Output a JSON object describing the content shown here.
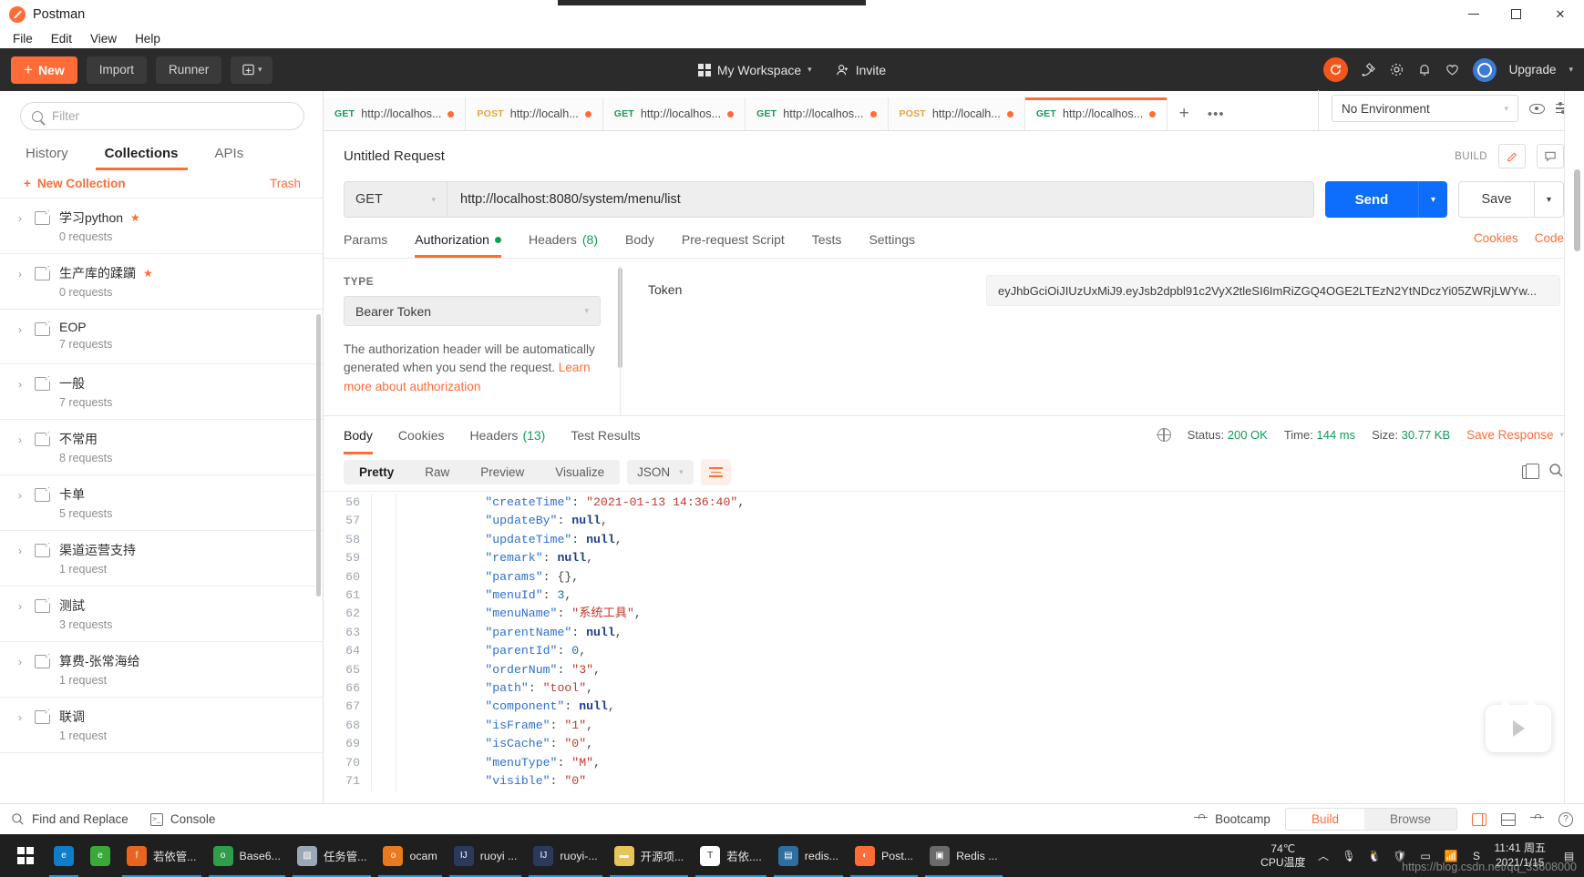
{
  "window": {
    "title": "Postman",
    "minimize": "—",
    "maximize": "▢",
    "close": "✕"
  },
  "menubar": {
    "items": [
      "File",
      "Edit",
      "View",
      "Help"
    ]
  },
  "toolbar": {
    "new_label": "New",
    "new_plus": "+",
    "import_label": "Import",
    "runner_label": "Runner",
    "workspace_label": "My Workspace",
    "workspace_caret": "▾",
    "invite_label": "Invite",
    "upgrade_label": "Upgrade",
    "upgrade_caret": "▾",
    "sync_icon": "refresh-icon",
    "accent": "#ff6c37"
  },
  "sidebar": {
    "search": {
      "placeholder": "Filter",
      "value": ""
    },
    "tabs": [
      {
        "label": "History",
        "active": false
      },
      {
        "label": "Collections",
        "active": true
      },
      {
        "label": "APIs",
        "active": false
      }
    ],
    "new_collection": "New Collection",
    "new_collection_plus": "+",
    "trash": "Trash",
    "collections": [
      {
        "name": "学习python",
        "count": "0 requests",
        "starred": true
      },
      {
        "name": "生产库的蹂躏",
        "count": "0 requests",
        "starred": true
      },
      {
        "name": "EOP",
        "count": "7 requests",
        "starred": false
      },
      {
        "name": "一般",
        "count": "7 requests",
        "starred": false
      },
      {
        "name": "不常用",
        "count": "8 requests",
        "starred": false
      },
      {
        "name": "卡单",
        "count": "5 requests",
        "starred": false
      },
      {
        "name": "渠道运营支持",
        "count": "1 request",
        "starred": false
      },
      {
        "name": "测試",
        "count": "3 requests",
        "starred": false
      },
      {
        "name": "算费-张常海给",
        "count": "1 request",
        "starred": false
      },
      {
        "name": "联调",
        "count": "1 request",
        "starred": false
      }
    ]
  },
  "request_tabs": {
    "items": [
      {
        "method": "GET",
        "url": "http://localhos...",
        "unsaved": true,
        "active": false
      },
      {
        "method": "POST",
        "url": "http://localh...",
        "unsaved": true,
        "active": false
      },
      {
        "method": "GET",
        "url": "http://localhos...",
        "unsaved": true,
        "active": false
      },
      {
        "method": "GET",
        "url": "http://localhos...",
        "unsaved": true,
        "active": false
      },
      {
        "method": "POST",
        "url": "http://localh...",
        "unsaved": true,
        "active": false
      },
      {
        "method": "GET",
        "url": "http://localhos...",
        "unsaved": true,
        "active": true
      }
    ],
    "add": "+",
    "more": "•••"
  },
  "environment": {
    "selected": "No Environment",
    "caret": "▾",
    "eye_icon": "eye-icon",
    "settings_icon": "sliders-icon"
  },
  "request": {
    "name": "Untitled Request",
    "build_label": "BUILD",
    "method": "GET",
    "method_caret": "▾",
    "url": "http://localhost:8080/system/menu/list",
    "send_label": "Send",
    "send_caret": "▾",
    "save_label": "Save",
    "save_caret": "▾",
    "tabs": [
      {
        "label": "Params",
        "active": false,
        "dot": false,
        "count": ""
      },
      {
        "label": "Authorization",
        "active": true,
        "dot": true,
        "count": ""
      },
      {
        "label": "Headers",
        "active": false,
        "dot": false,
        "count": "(8)"
      },
      {
        "label": "Body",
        "active": false,
        "dot": false,
        "count": ""
      },
      {
        "label": "Pre-request Script",
        "active": false,
        "dot": false,
        "count": ""
      },
      {
        "label": "Tests",
        "active": false,
        "dot": false,
        "count": ""
      },
      {
        "label": "Settings",
        "active": false,
        "dot": false,
        "count": ""
      }
    ],
    "cookies_link": "Cookies",
    "code_link": "Code"
  },
  "authorization": {
    "type_label": "TYPE",
    "type_value": "Bearer Token",
    "type_caret": "▾",
    "note_text": "The authorization header will be automatically generated when you send the request. ",
    "note_link": "Learn more about authorization",
    "token_label": "Token",
    "token_value": "eyJhbGciOiJIUzUxMiJ9.eyJsb2dpbl91c2VyX2tleSI6ImRiZGQ4OGE2LTEzN2YtNDczYi05ZWRjLWYw..."
  },
  "response": {
    "tabs": [
      {
        "label": "Body",
        "active": true,
        "count": ""
      },
      {
        "label": "Cookies",
        "active": false,
        "count": ""
      },
      {
        "label": "Headers",
        "active": false,
        "count": "(13)"
      },
      {
        "label": "Test Results",
        "active": false,
        "count": ""
      }
    ],
    "status_label": "Status:",
    "status_value": "200 OK",
    "time_label": "Time:",
    "time_value": "144 ms",
    "size_label": "Size:",
    "size_value": "30.77 KB",
    "save_response": "Save Response",
    "save_response_caret": "▾",
    "formats": [
      {
        "label": "Pretty",
        "active": true
      },
      {
        "label": "Raw",
        "active": false
      },
      {
        "label": "Preview",
        "active": false
      },
      {
        "label": "Visualize",
        "active": false
      }
    ],
    "language": "JSON",
    "language_caret": "▾",
    "wrap_icon": "word-wrap-icon",
    "copy_icon": "copy-icon",
    "search_icon": "search-icon",
    "code_lines": [
      {
        "num": "56",
        "parts": [
          {
            "t": "\"createTime\"",
            "c": "k"
          },
          {
            "t": ": ",
            "c": "p"
          },
          {
            "t": "\"2021-01-13 14:36:40\"",
            "c": "s"
          },
          {
            "t": ",",
            "c": "p"
          }
        ]
      },
      {
        "num": "57",
        "parts": [
          {
            "t": "\"updateBy\"",
            "c": "k"
          },
          {
            "t": ": ",
            "c": "p"
          },
          {
            "t": "null",
            "c": "nul"
          },
          {
            "t": ",",
            "c": "p"
          }
        ]
      },
      {
        "num": "58",
        "parts": [
          {
            "t": "\"updateTime\"",
            "c": "k"
          },
          {
            "t": ": ",
            "c": "p"
          },
          {
            "t": "null",
            "c": "nul"
          },
          {
            "t": ",",
            "c": "p"
          }
        ]
      },
      {
        "num": "59",
        "parts": [
          {
            "t": "\"remark\"",
            "c": "k"
          },
          {
            "t": ": ",
            "c": "p"
          },
          {
            "t": "null",
            "c": "nul"
          },
          {
            "t": ",",
            "c": "p"
          }
        ]
      },
      {
        "num": "60",
        "parts": [
          {
            "t": "\"params\"",
            "c": "k"
          },
          {
            "t": ": {},",
            "c": "p"
          }
        ]
      },
      {
        "num": "61",
        "parts": [
          {
            "t": "\"menuId\"",
            "c": "k"
          },
          {
            "t": ": ",
            "c": "p"
          },
          {
            "t": "3",
            "c": "n"
          },
          {
            "t": ",",
            "c": "p"
          }
        ]
      },
      {
        "num": "62",
        "parts": [
          {
            "t": "\"menuName\"",
            "c": "k"
          },
          {
            "t": ": ",
            "c": "p"
          },
          {
            "t": "\"系统工具\"",
            "c": "s"
          },
          {
            "t": ",",
            "c": "p"
          }
        ]
      },
      {
        "num": "63",
        "parts": [
          {
            "t": "\"parentName\"",
            "c": "k"
          },
          {
            "t": ": ",
            "c": "p"
          },
          {
            "t": "null",
            "c": "nul"
          },
          {
            "t": ",",
            "c": "p"
          }
        ]
      },
      {
        "num": "64",
        "parts": [
          {
            "t": "\"parentId\"",
            "c": "k"
          },
          {
            "t": ": ",
            "c": "p"
          },
          {
            "t": "0",
            "c": "n"
          },
          {
            "t": ",",
            "c": "p"
          }
        ]
      },
      {
        "num": "65",
        "parts": [
          {
            "t": "\"orderNum\"",
            "c": "k"
          },
          {
            "t": ": ",
            "c": "p"
          },
          {
            "t": "\"3\"",
            "c": "s"
          },
          {
            "t": ",",
            "c": "p"
          }
        ]
      },
      {
        "num": "66",
        "parts": [
          {
            "t": "\"path\"",
            "c": "k"
          },
          {
            "t": ": ",
            "c": "p"
          },
          {
            "t": "\"tool\"",
            "c": "s"
          },
          {
            "t": ",",
            "c": "p"
          }
        ]
      },
      {
        "num": "67",
        "parts": [
          {
            "t": "\"component\"",
            "c": "k"
          },
          {
            "t": ": ",
            "c": "p"
          },
          {
            "t": "null",
            "c": "nul"
          },
          {
            "t": ",",
            "c": "p"
          }
        ]
      },
      {
        "num": "68",
        "parts": [
          {
            "t": "\"isFrame\"",
            "c": "k"
          },
          {
            "t": ": ",
            "c": "p"
          },
          {
            "t": "\"1\"",
            "c": "s"
          },
          {
            "t": ",",
            "c": "p"
          }
        ]
      },
      {
        "num": "69",
        "parts": [
          {
            "t": "\"isCache\"",
            "c": "k"
          },
          {
            "t": ": ",
            "c": "p"
          },
          {
            "t": "\"0\"",
            "c": "s"
          },
          {
            "t": ",",
            "c": "p"
          }
        ]
      },
      {
        "num": "70",
        "parts": [
          {
            "t": "\"menuType\"",
            "c": "k"
          },
          {
            "t": ": ",
            "c": "p"
          },
          {
            "t": "\"M\"",
            "c": "s"
          },
          {
            "t": ",",
            "c": "p"
          }
        ]
      },
      {
        "num": "71",
        "parts": [
          {
            "t": "\"visible\"",
            "c": "k"
          },
          {
            "t": ": ",
            "c": "p"
          },
          {
            "t": "\"0\"",
            "c": "s"
          }
        ]
      }
    ]
  },
  "statusbar": {
    "find_replace": "Find and Replace",
    "console": "Console",
    "bootcamp": "Bootcamp",
    "build": "Build",
    "browse": "Browse",
    "two_pane_icon": "two-pane-icon",
    "split_pane_icon": "split-pane-icon",
    "keyboard_icon": "keyboard-icon",
    "help_icon": "help-icon"
  },
  "taskbar": {
    "start_icon": "windows-start-icon",
    "apps": [
      {
        "label": "",
        "icon": "edge-icon",
        "color": "#0f7ec8",
        "glyph": "e",
        "open": true
      },
      {
        "label": "",
        "icon": "ie-icon",
        "color": "#3aa93a",
        "glyph": "e",
        "open": false
      },
      {
        "label": "若依管...",
        "icon": "firefox-icon",
        "color": "#e8641f",
        "glyph": "f",
        "open": true
      },
      {
        "label": "Base6...",
        "icon": "chrome-icon",
        "color": "#2e9e4a",
        "glyph": "o",
        "open": true
      },
      {
        "label": "任务管...",
        "icon": "taskmgr-icon",
        "color": "#9aa8b5",
        "glyph": "▨",
        "open": true
      },
      {
        "label": "ocam",
        "icon": "ocam-icon",
        "color": "#e87a1f",
        "glyph": "o",
        "open": true
      },
      {
        "label": "ruoyi ...",
        "icon": "intellij-icon",
        "color": "#2b3a5c",
        "glyph": "IJ",
        "open": true
      },
      {
        "label": "ruoyi-...",
        "icon": "intellij-icon",
        "color": "#2b3a5c",
        "glyph": "IJ",
        "open": true
      },
      {
        "label": "开源项...",
        "icon": "folder-icon",
        "color": "#e8c35a",
        "glyph": "▬",
        "open": true
      },
      {
        "label": "若依....",
        "icon": "typora-icon",
        "color": "#ffffff",
        "glyph": "T",
        "open": true
      },
      {
        "label": "redis...",
        "icon": "redis-desktop-icon",
        "color": "#2f6f9f",
        "glyph": "▤",
        "open": true
      },
      {
        "label": "Post...",
        "icon": "postman-icon",
        "color": "#ff6c37",
        "glyph": "◐",
        "open": true
      },
      {
        "label": "Redis ...",
        "icon": "redis-icon",
        "color": "#6b6b6b",
        "glyph": "▣",
        "open": true
      }
    ],
    "cpu_temp": "74℃",
    "cpu_temp_label": "CPU温度",
    "tray_chevron": "︿",
    "tray_icons": [
      "mic-icon",
      "penguin-icon",
      "shield-icon",
      "battery-icon",
      "network-icon",
      "sogou-icon"
    ],
    "clock_time": "11:41 周五",
    "clock_date": "2021/1/15",
    "notification_icon": "notification-icon",
    "watermark": "https://blog.csdn.net/qq_33608000"
  }
}
